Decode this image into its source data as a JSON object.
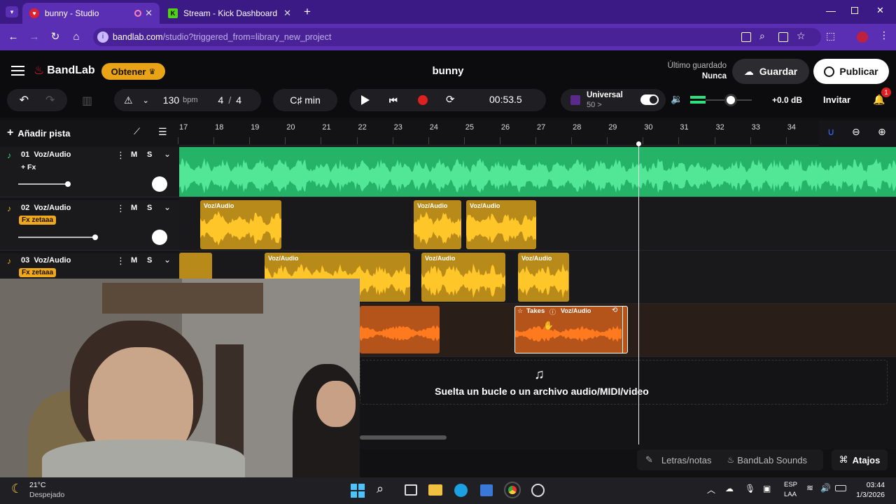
{
  "browser": {
    "tabs": [
      {
        "title": "bunny - Studio",
        "active": true
      },
      {
        "title": "Stream - Kick Dashboard",
        "active": false
      }
    ],
    "url_host": "bandlab.com",
    "url_path": "/studio?triggered_from=library_new_project"
  },
  "app": {
    "brand": "BandLab",
    "obtain_label": "Obtener",
    "project_title": "bunny",
    "last_saved_label": "Último guardado",
    "last_saved_value": "Nunca",
    "save_label": "Guardar",
    "publish_label": "Publicar"
  },
  "toolbar": {
    "tempo": "130",
    "tempo_unit": "bpm",
    "time_sig_num": "4",
    "time_sig_sep": "/",
    "time_sig_den": "4",
    "key": "C♯ min",
    "time": "00:53.5",
    "instrument_name": "Universal",
    "instrument_sub": "50 >",
    "db": "+0.0 dB",
    "invite_label": "Invitar",
    "notif_count": "1",
    "accent": "#e8a317",
    "record_color": "#e02020"
  },
  "timeline": {
    "add_track_label": "Añadir pista",
    "bars": [
      "17",
      "18",
      "19",
      "20",
      "21",
      "22",
      "23",
      "24",
      "25",
      "26",
      "27",
      "28",
      "29",
      "30",
      "31",
      "32",
      "33",
      "34"
    ]
  },
  "tracks": [
    {
      "num": "01",
      "name": "Voz/Audio",
      "fx": "+ Fx",
      "m": "M",
      "s": "S",
      "color": "#2ee07e"
    },
    {
      "num": "02",
      "name": "Voz/Audio",
      "fx": "Fx zetaaa",
      "m": "M",
      "s": "S",
      "color": "#f0b020"
    },
    {
      "num": "03",
      "name": "Voz/Audio",
      "fx": "Fx zetaaa",
      "m": "M",
      "s": "S",
      "color": "#f0b020"
    }
  ],
  "clips": {
    "voz": "Voz/Audio",
    "takes": "Takes"
  },
  "dropzone": "Suelta un bucle o un archivo audio/MIDI/video",
  "bottom": {
    "lyrics_label": "Letras/notas",
    "sounds_label": "BandLab Sounds",
    "shortcuts_label": "Atajos"
  },
  "taskbar": {
    "temp": "21°C",
    "weather": "Despejado",
    "lang1": "ESP",
    "lang2": "LAA",
    "clock": "03:44",
    "date": "1/3/2026"
  }
}
